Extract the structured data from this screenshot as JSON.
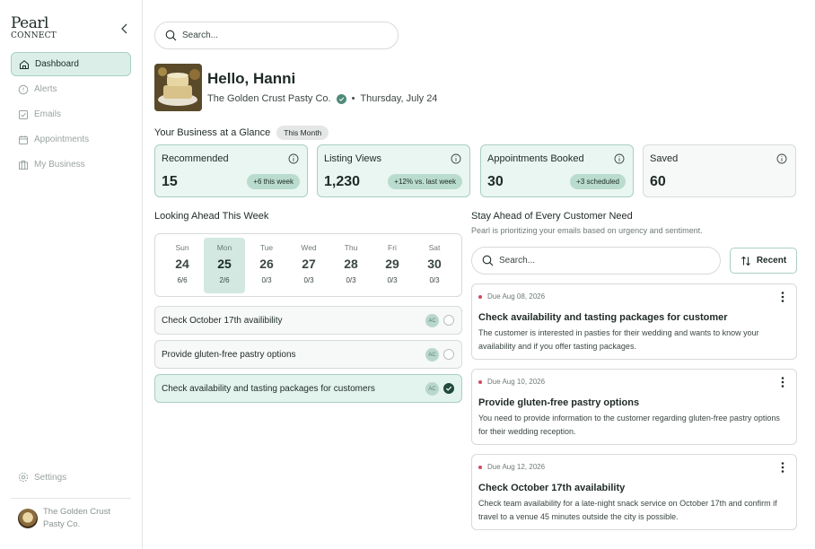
{
  "brand": {
    "name": "Pearl",
    "sub": "CONNECT"
  },
  "nav": [
    {
      "label": "Dashboard",
      "icon": "home-icon",
      "active": true
    },
    {
      "label": "Alerts",
      "icon": "alert-icon"
    },
    {
      "label": "Emails",
      "icon": "email-icon"
    },
    {
      "label": "Appointments",
      "icon": "calendar-icon"
    },
    {
      "label": "My Business",
      "icon": "business-icon"
    }
  ],
  "settings_label": "Settings",
  "account": {
    "name": "The Golden Crust Pasty Co."
  },
  "search": {
    "placeholder": "Search..."
  },
  "greeting": "Hello, Hanni",
  "business_name": "The Golden Crust Pasty Co.",
  "date": "Thursday, July 24",
  "glance": {
    "title": "Your Business at a Glance",
    "period": "This Month",
    "stats": [
      {
        "label": "Recommended",
        "value": "15",
        "tag": "+6 this week"
      },
      {
        "label": "Listing Views",
        "value": "1,230",
        "tag": "+12% vs. last week"
      },
      {
        "label": "Appointments Booked",
        "value": "30",
        "tag": "+3 scheduled"
      },
      {
        "label": "Saved",
        "value": "60",
        "tag": ""
      }
    ]
  },
  "week": {
    "title": "Looking Ahead This Week",
    "days": [
      {
        "name": "Sun",
        "date": "24",
        "count": "6/6"
      },
      {
        "name": "Mon",
        "date": "25",
        "count": "2/6",
        "selected": true
      },
      {
        "name": "Tue",
        "date": "26",
        "count": "0/3"
      },
      {
        "name": "Wed",
        "date": "27",
        "count": "0/3"
      },
      {
        "name": "Thu",
        "date": "28",
        "count": "0/3"
      },
      {
        "name": "Fri",
        "date": "29",
        "count": "0/3"
      },
      {
        "name": "Sat",
        "date": "30",
        "count": "0/3"
      }
    ],
    "tasks": [
      {
        "label": "Check October 17th availibility",
        "assignee": "AC",
        "done": false
      },
      {
        "label": "Provide gluten-free pastry options",
        "assignee": "AC",
        "done": false
      },
      {
        "label": "Check availability and tasting packages for customers",
        "assignee": "AC",
        "done": true
      }
    ]
  },
  "needs": {
    "title": "Stay Ahead of Every Customer Need",
    "subtitle": "Pearl is prioritizing your emails based on urgency and sentiment.",
    "search_placeholder": "Search...",
    "sort_label": "Recent",
    "cards": [
      {
        "due": "Due Aug 08, 2026",
        "title": "Check availability and tasting packages for customer",
        "desc": "The customer is interested in pasties for their wedding and wants to know your availability and if you offer tasting packages."
      },
      {
        "due": "Due Aug 10, 2026",
        "title": "Provide gluten-free pastry options",
        "desc": "You need to provide information to the customer regarding gluten-free pastry options for their wedding reception."
      },
      {
        "due": "Due Aug 12, 2026",
        "title": "Check October 17th availability",
        "desc": "Check team availability for a late-night snack service on October 17th and confirm if travel to a venue 45 minutes outside the city is possible."
      }
    ]
  },
  "colors": {
    "accent": "#a8cfc2",
    "accent_bg": "#eaf6f1",
    "dark_green": "#1f4a3e",
    "due_dot": "#d04a5c"
  }
}
